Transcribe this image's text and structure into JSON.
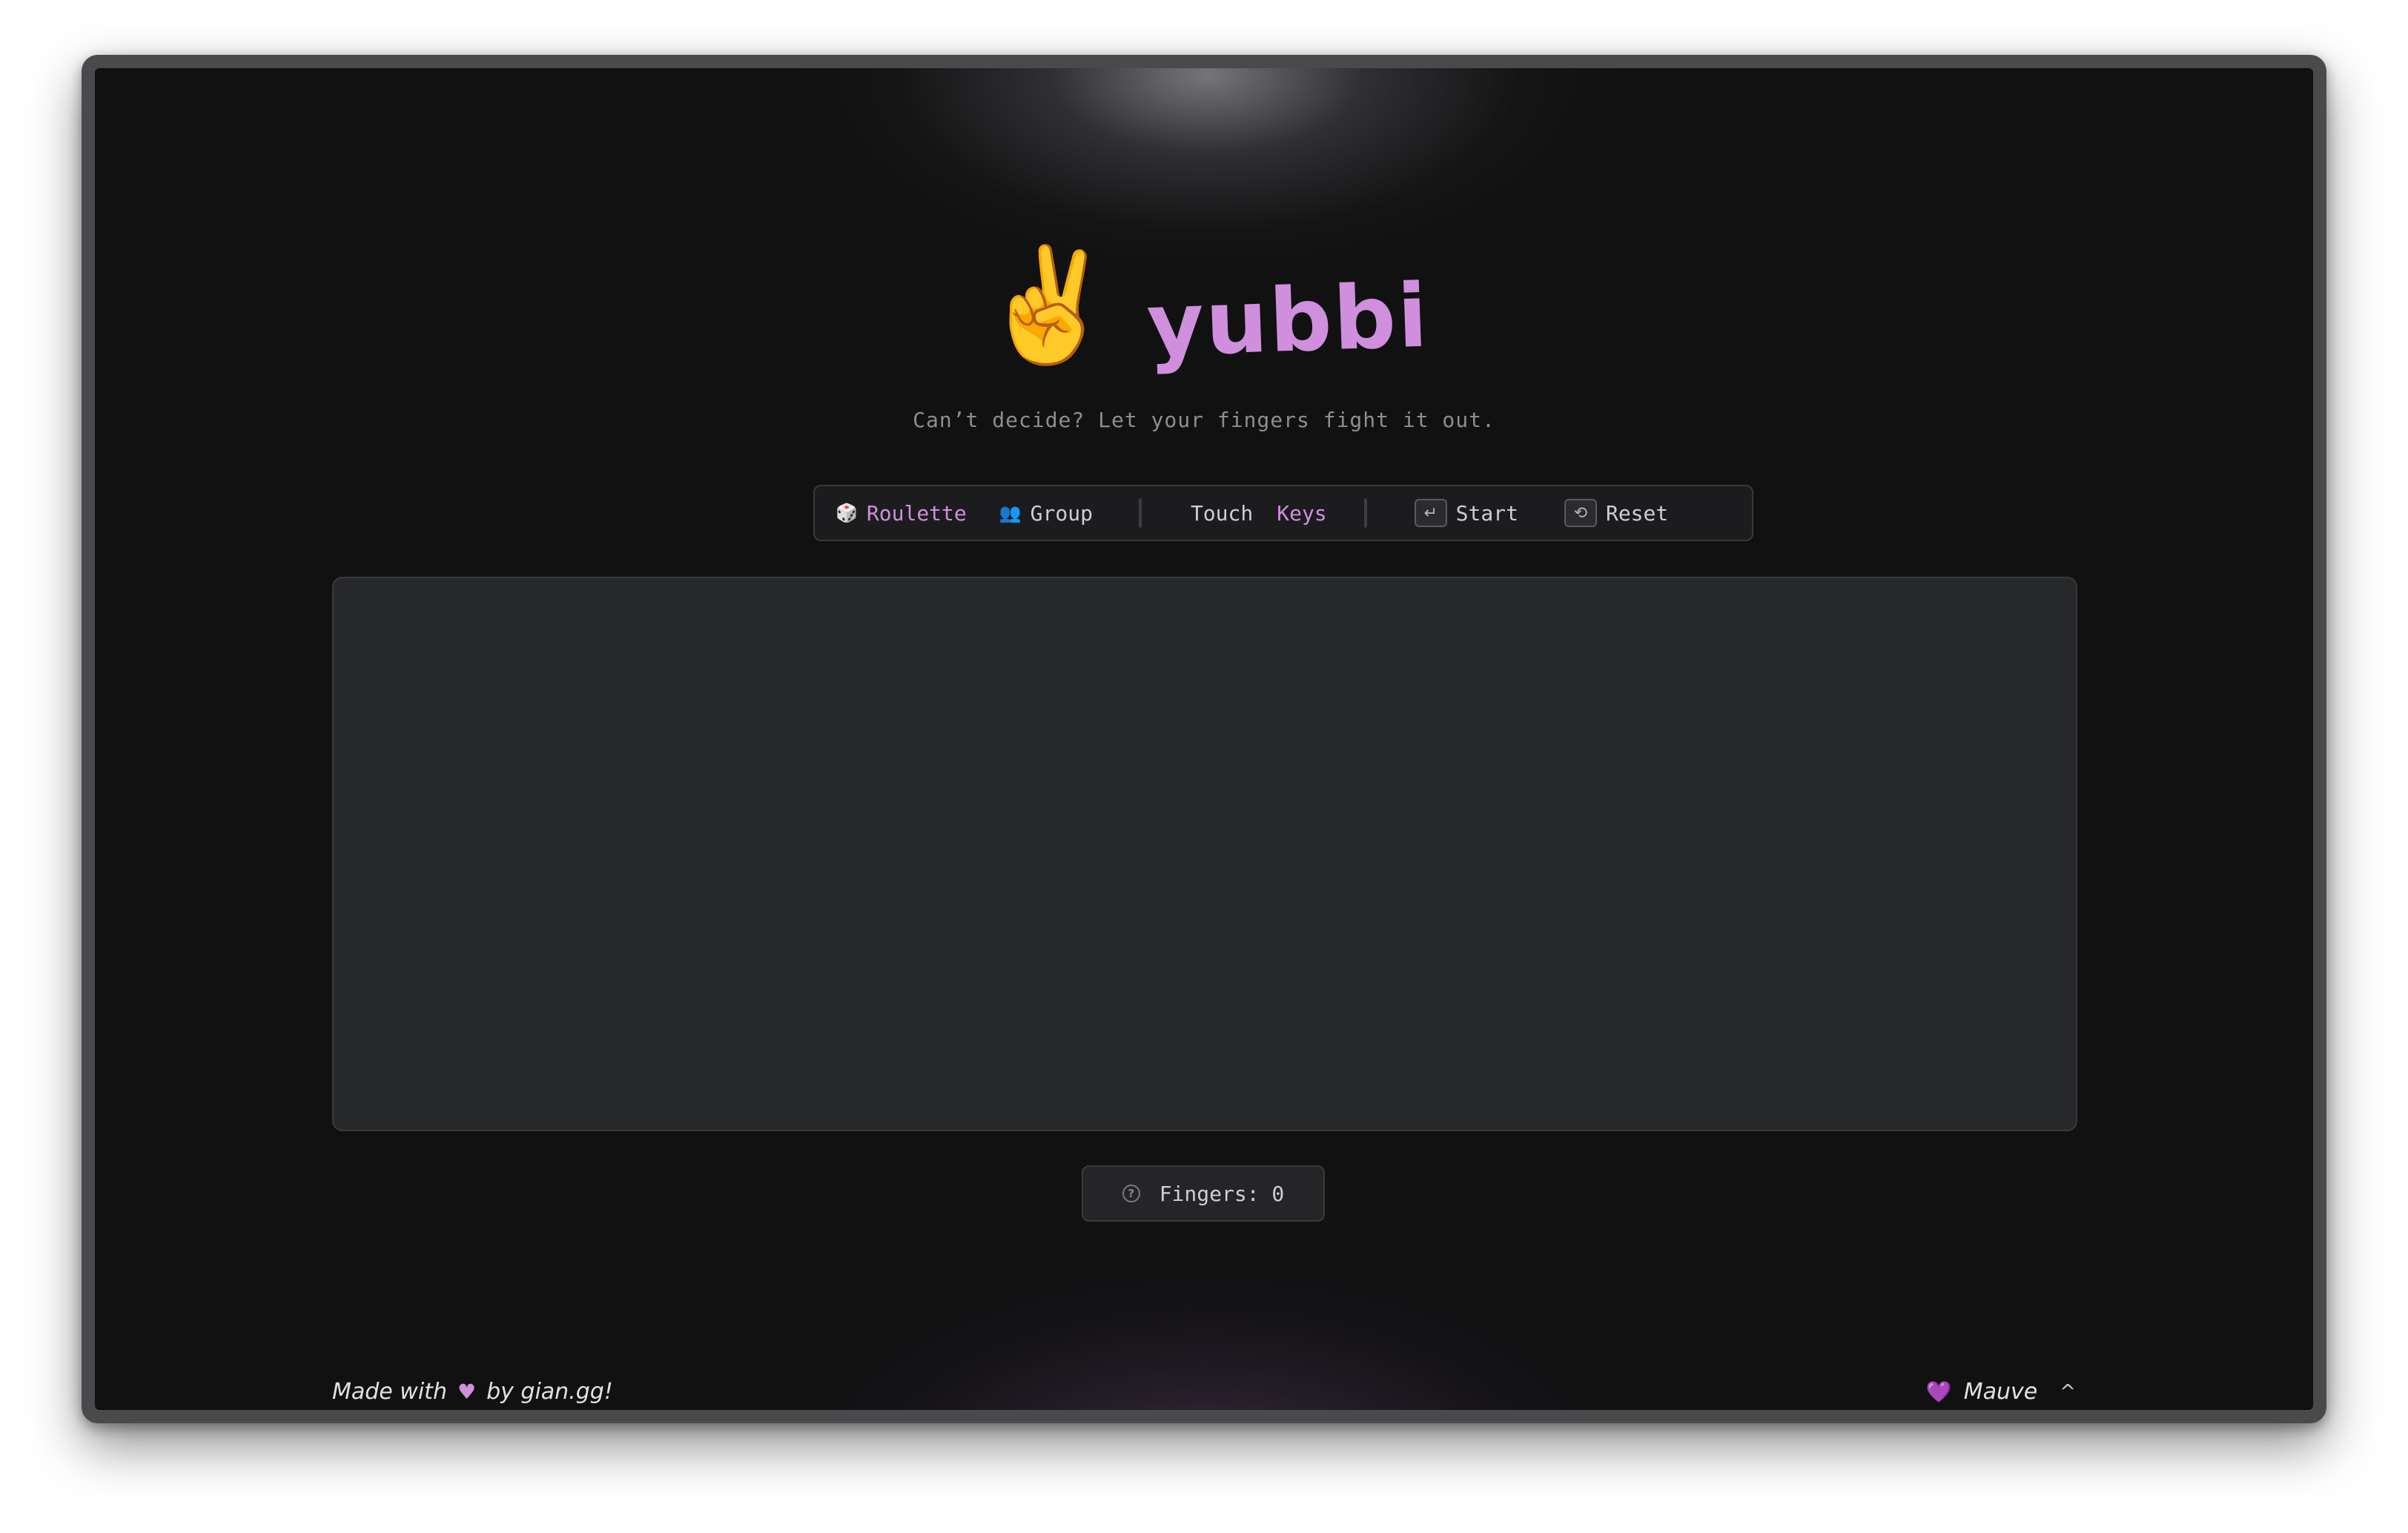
{
  "app": {
    "logo_emoji": "✌️",
    "logo_text": "yubbi",
    "tagline": "Can’t decide? Let your fingers fight it out."
  },
  "toolbar": {
    "modes": [
      {
        "icon": "dice-icon",
        "glyph": "🎲",
        "label": "Roulette",
        "active": true
      },
      {
        "icon": "group-icon",
        "glyph": "👥",
        "label": "Group",
        "active": false
      }
    ],
    "input": [
      {
        "label": "Touch",
        "active": false
      },
      {
        "label": "Keys",
        "active": true
      }
    ],
    "actions": [
      {
        "icon": "enter-key-icon",
        "glyph": "↵",
        "label": "Start"
      },
      {
        "icon": "reset-icon",
        "glyph": "⟲",
        "label": "Reset"
      }
    ]
  },
  "counter": {
    "icon": "help-icon",
    "glyph": "?",
    "label": "Fingers: 0"
  },
  "footer": {
    "made_with": "Made with",
    "heart": "♥",
    "by": "by gian.gg!",
    "theme_heart": "💜",
    "theme_label": "Mauve",
    "theme_chevron": "^"
  },
  "colors": {
    "accent": "#cf8fdd",
    "background": "#111112",
    "panel": "#27282a",
    "theme_heart": "#8b3fd6"
  }
}
